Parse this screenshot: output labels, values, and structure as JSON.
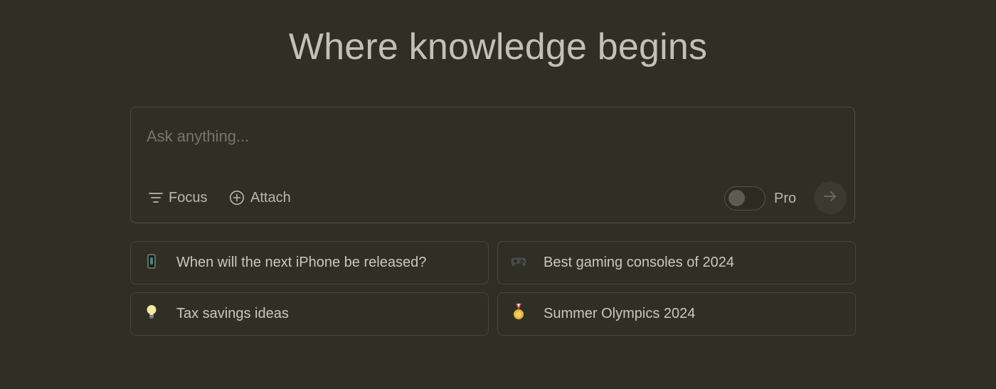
{
  "headline": "Where knowledge begins",
  "search": {
    "placeholder": "Ask anything...",
    "focus_label": "Focus",
    "attach_label": "Attach",
    "pro_label": "Pro",
    "pro_enabled": false
  },
  "suggestions": [
    {
      "icon": "phone-icon",
      "label": "When will the next iPhone be released?"
    },
    {
      "icon": "game-controller-icon",
      "label": "Best gaming consoles of 2024"
    },
    {
      "icon": "light-bulb-icon",
      "label": "Tax savings ideas"
    },
    {
      "icon": "medal-icon",
      "label": "Summer Olympics 2024"
    }
  ],
  "colors": {
    "background": "#2f2f25",
    "border": "#4d4d44",
    "text": "#c9c8bd",
    "muted_text": "#77766c"
  }
}
